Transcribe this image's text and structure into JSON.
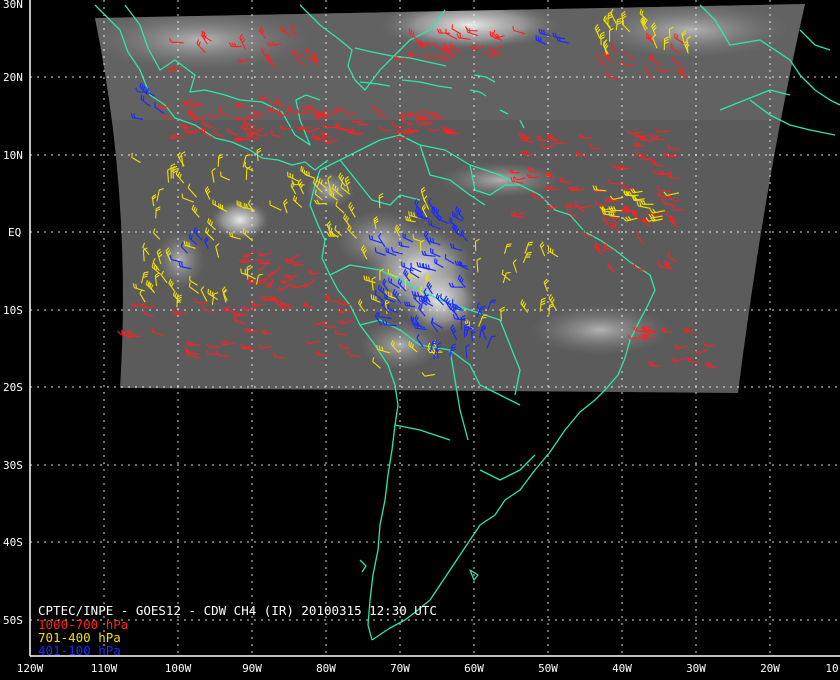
{
  "map": {
    "title": "CPTEC/INPE - GOES12 - CDW CH4 (IR) 20100315 12:30 UTC",
    "lat_labels": [
      "30N",
      "20N",
      "10N",
      "EQ",
      "10S",
      "20S",
      "30S",
      "40S",
      "50S"
    ],
    "lon_labels": [
      "120W",
      "110W",
      "100W",
      "90W",
      "80W",
      "70W",
      "60W",
      "50W",
      "40W",
      "30W",
      "20W",
      "10"
    ],
    "legend": [
      {
        "label": "1000-700 hPa",
        "color": "#ff2020"
      },
      {
        "label": "701-400 hPa",
        "color": "#f2e000"
      },
      {
        "label": "401-100 hPa",
        "color": "#1a2cff"
      }
    ],
    "coast_color": "#2ee6a8",
    "grid_color": "#ffffff",
    "background": "#000000"
  }
}
